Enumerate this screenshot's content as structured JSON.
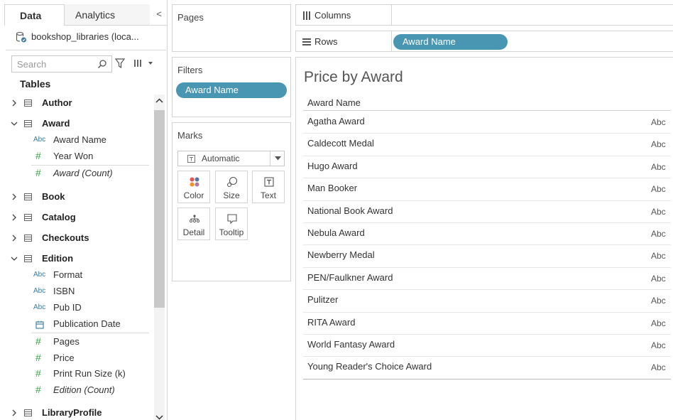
{
  "tabs": {
    "data": "Data",
    "analytics": "Analytics"
  },
  "collapse_glyph": "<",
  "datasource": {
    "name": "bookshop_libraries (loca...",
    "icon": "database-icon"
  },
  "search": {
    "placeholder": "Search"
  },
  "tables_label": "Tables",
  "tables": [
    {
      "label": "Author",
      "expanded": false
    },
    {
      "label": "Award",
      "expanded": true,
      "fields": [
        {
          "type": "Abc",
          "label": "Award Name",
          "italic": false
        },
        {
          "type": "#",
          "label": "Year Won",
          "italic": false
        },
        {
          "type": "#",
          "label": "Award (Count)",
          "italic": true
        }
      ]
    },
    {
      "label": "Book",
      "expanded": false
    },
    {
      "label": "Catalog",
      "expanded": false
    },
    {
      "label": "Checkouts",
      "expanded": false
    },
    {
      "label": "Edition",
      "expanded": true,
      "fields": [
        {
          "type": "Abc",
          "label": "Format",
          "italic": false
        },
        {
          "type": "Abc",
          "label": "ISBN",
          "italic": false
        },
        {
          "type": "Abc",
          "label": "Pub ID",
          "italic": false
        },
        {
          "type": "calendar",
          "label": "Publication Date",
          "italic": false
        },
        {
          "type": "#",
          "label": "Pages",
          "italic": false
        },
        {
          "type": "#",
          "label": "Price",
          "italic": false
        },
        {
          "type": "#",
          "label": "Print Run Size (k)",
          "italic": false
        },
        {
          "type": "#",
          "label": "Edition (Count)",
          "italic": true
        }
      ]
    },
    {
      "label": "LibraryProfile",
      "expanded": false
    }
  ],
  "cards": {
    "pages": "Pages",
    "filters": "Filters",
    "filter_pill": "Award Name",
    "marks": "Marks",
    "mark_type": "Automatic",
    "mark_buttons": [
      "Color",
      "Size",
      "Text",
      "Detail",
      "Tooltip"
    ]
  },
  "shelves": {
    "columns": "Columns",
    "rows": "Rows",
    "rows_pill": "Award Name"
  },
  "view": {
    "title": "Price by Award",
    "column_header": "Award Name",
    "placeholder": "Abc",
    "rows": [
      "Agatha Award",
      "Caldecott Medal",
      "Hugo Award",
      "Man Booker",
      "National Book Award",
      "Nebula Award",
      "Newberry Medal",
      "PEN/Faulkner Award",
      "Pulitzer",
      "RITA Award",
      "World Fantasy Award",
      "Young Reader's Choice Award"
    ]
  },
  "colors": {
    "pill": "#4996b2",
    "dimension_icon": "#3b7aa0",
    "measure_icon": "#3ea04a"
  }
}
